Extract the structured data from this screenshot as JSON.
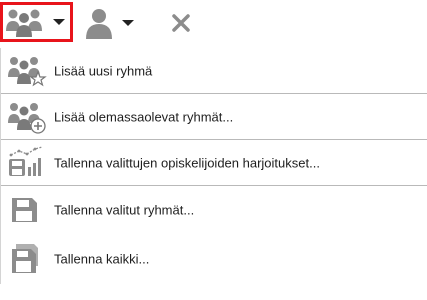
{
  "toolbar": {
    "groups_button": {
      "icon": "groups-icon",
      "selected": true
    },
    "user_button": {
      "icon": "user-icon"
    },
    "close_button": {
      "icon": "close-icon"
    }
  },
  "menu": {
    "items": [
      {
        "label": "Lisää uusi ryhmä",
        "icon": "group-star-icon"
      },
      {
        "label": "Lisää olemassaolevat ryhmät...",
        "icon": "group-add-icon"
      },
      {
        "label": "Tallenna valittujen opiskelijoiden harjoitukset...",
        "icon": "save-chart-icon"
      },
      {
        "label": "Tallenna valitut ryhmät...",
        "icon": "save-icon"
      },
      {
        "label": "Tallenna kaikki...",
        "icon": "save-all-icon"
      }
    ]
  },
  "colors": {
    "icon_gray": "#8a8a8a",
    "highlight_border": "#e8141b"
  }
}
